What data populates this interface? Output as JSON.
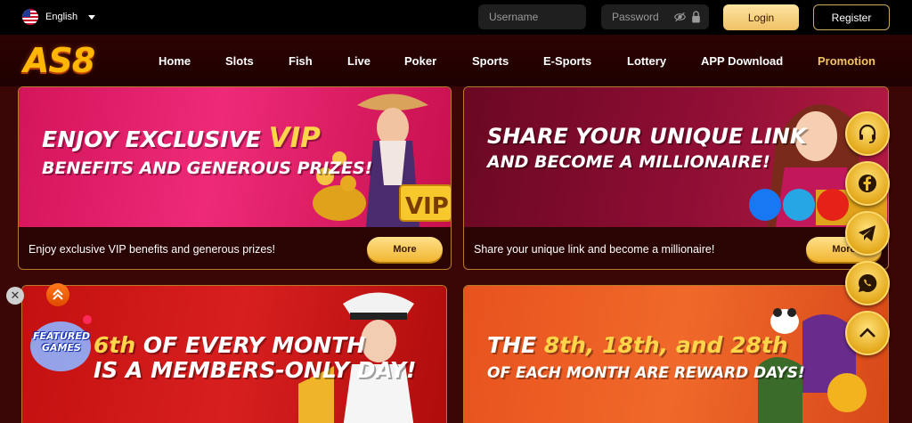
{
  "header": {
    "language": "English",
    "username_placeholder": "Username",
    "password_placeholder": "Password",
    "login_label": "Login",
    "register_label": "Register"
  },
  "nav": {
    "logo": "AS8",
    "items": [
      "Home",
      "Slots",
      "Fish",
      "Live",
      "Poker",
      "Sports",
      "E-Sports",
      "Lottery",
      "APP Download",
      "Promotion"
    ],
    "active": "Promotion"
  },
  "promotions": [
    {
      "headline_line1_white": "ENJOY EXCLUSIVE ",
      "headline_line1_gold": "VIP",
      "headline_line2": "BENEFITS AND GENEROUS PRIZES!",
      "badge": "VIP",
      "description": "Enjoy exclusive VIP benefits and generous prizes!",
      "button": "More"
    },
    {
      "headline_line1": "SHARE YOUR UNIQUE LINK",
      "headline_line2": "AND BECOME A MILLIONAIRE!",
      "description": "Share your unique link and become a millionaire!",
      "button": "More"
    },
    {
      "headline_line1_gold": "6th",
      "headline_line1_white": " OF EVERY MONTH",
      "headline_line2": "IS A MEMBERS-ONLY DAY!"
    },
    {
      "headline_line1_white": "THE ",
      "headline_line1_gold": "8th, 18th, and 28th",
      "headline_line2": "OF EACH MONTH ARE REWARD DAYS!"
    }
  ],
  "featured_games_label": "FEATURED GAMES",
  "close_glyph": "✕",
  "icons": [
    "headset-icon",
    "facebook-icon",
    "telegram-icon",
    "whatsapp-icon",
    "chevron-up-icon",
    "eye-off-icon",
    "lock-icon"
  ],
  "colors": {
    "accent_gold": "#f2c46a",
    "background": "#3a0606",
    "card_border": "#b77a2b"
  }
}
